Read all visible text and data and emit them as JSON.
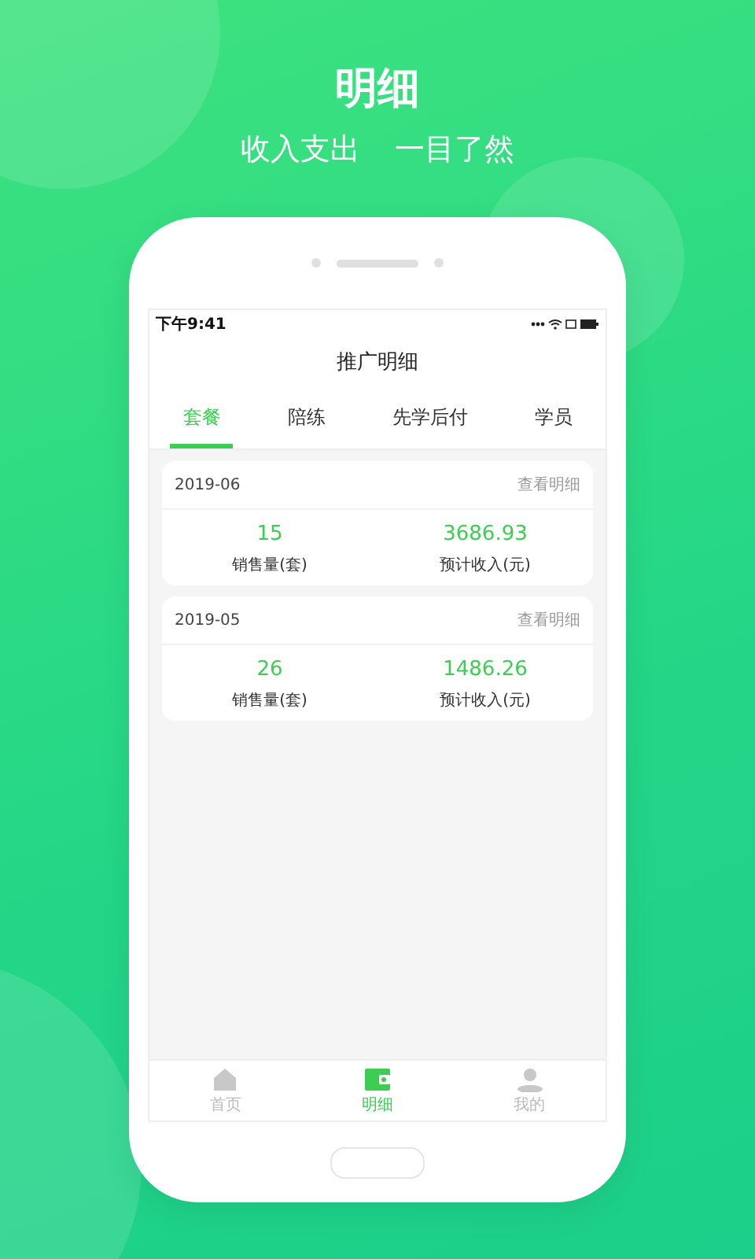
{
  "headline": {
    "title": "明细",
    "subtitle": [
      "收入支出",
      "一目了然"
    ]
  },
  "status_bar": {
    "time": "下午9:41"
  },
  "screen_title": "推广明细",
  "tabs": [
    {
      "label": "套餐",
      "selected": true
    },
    {
      "label": "陪练",
      "selected": false
    },
    {
      "label": "先学后付",
      "selected": false
    },
    {
      "label": "学员",
      "selected": false
    }
  ],
  "records": [
    {
      "month": "2019-06",
      "link": "查看明细",
      "stats": [
        {
          "value": "15",
          "label": "销售量(套)"
        },
        {
          "value": "3686.93",
          "label": "预计收入(元)"
        }
      ]
    },
    {
      "month": "2019-05",
      "link": "查看明细",
      "stats": [
        {
          "value": "26",
          "label": "销售量(套)"
        },
        {
          "value": "1486.26",
          "label": "预计收入(元)"
        }
      ]
    }
  ],
  "bottom_nav": [
    {
      "label": "首页",
      "kind": "home",
      "selected": false
    },
    {
      "label": "明细",
      "kind": "wallet",
      "selected": true
    },
    {
      "label": "我的",
      "kind": "person",
      "selected": false
    }
  ]
}
